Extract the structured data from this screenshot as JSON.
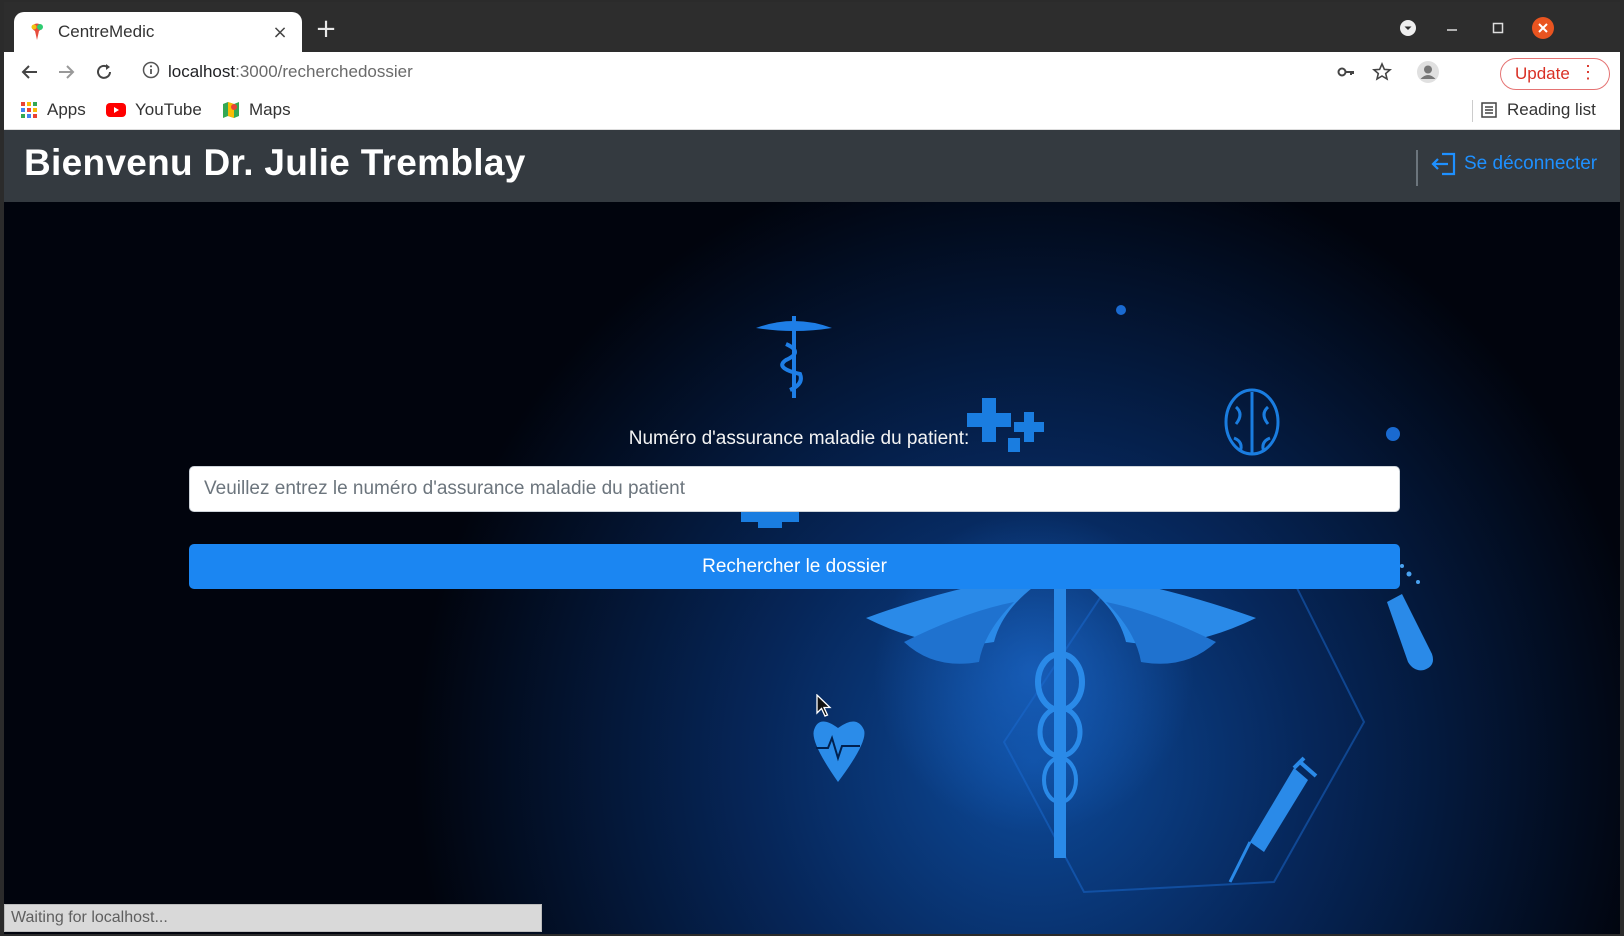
{
  "browser": {
    "tab_title": "CentreMedic",
    "tab_close": "×",
    "new_tab": "+",
    "url_host": "localhost",
    "url_path": ":3000/recherchedossier",
    "update_label": "Update",
    "update_menu": "⋮",
    "bookmarks": [
      {
        "label": "Apps",
        "icon": "apps-grid-icon"
      },
      {
        "label": "YouTube",
        "icon": "youtube-icon"
      },
      {
        "label": "Maps",
        "icon": "maps-icon"
      }
    ],
    "reading_list": "Reading list",
    "status_text": "Waiting for localhost..."
  },
  "navbar": {
    "brand": "Bienvenu Dr. Julie Tremblay",
    "logout_label": "Se déconnecter",
    "logout_icon": "logout-icon"
  },
  "form": {
    "label": "Numéro d'assurance maladie du patient:",
    "placeholder": "Veuillez entrez le numéro d'assurance maladie du patient",
    "value": "",
    "submit_label": "Rechercher le dossier"
  },
  "colors": {
    "navbar_bg": "#343a40",
    "primary": "#1b86f2",
    "logout_link": "#1e90ff",
    "hero_bg": "#01040d",
    "hero_accent": "#1a7de0"
  }
}
